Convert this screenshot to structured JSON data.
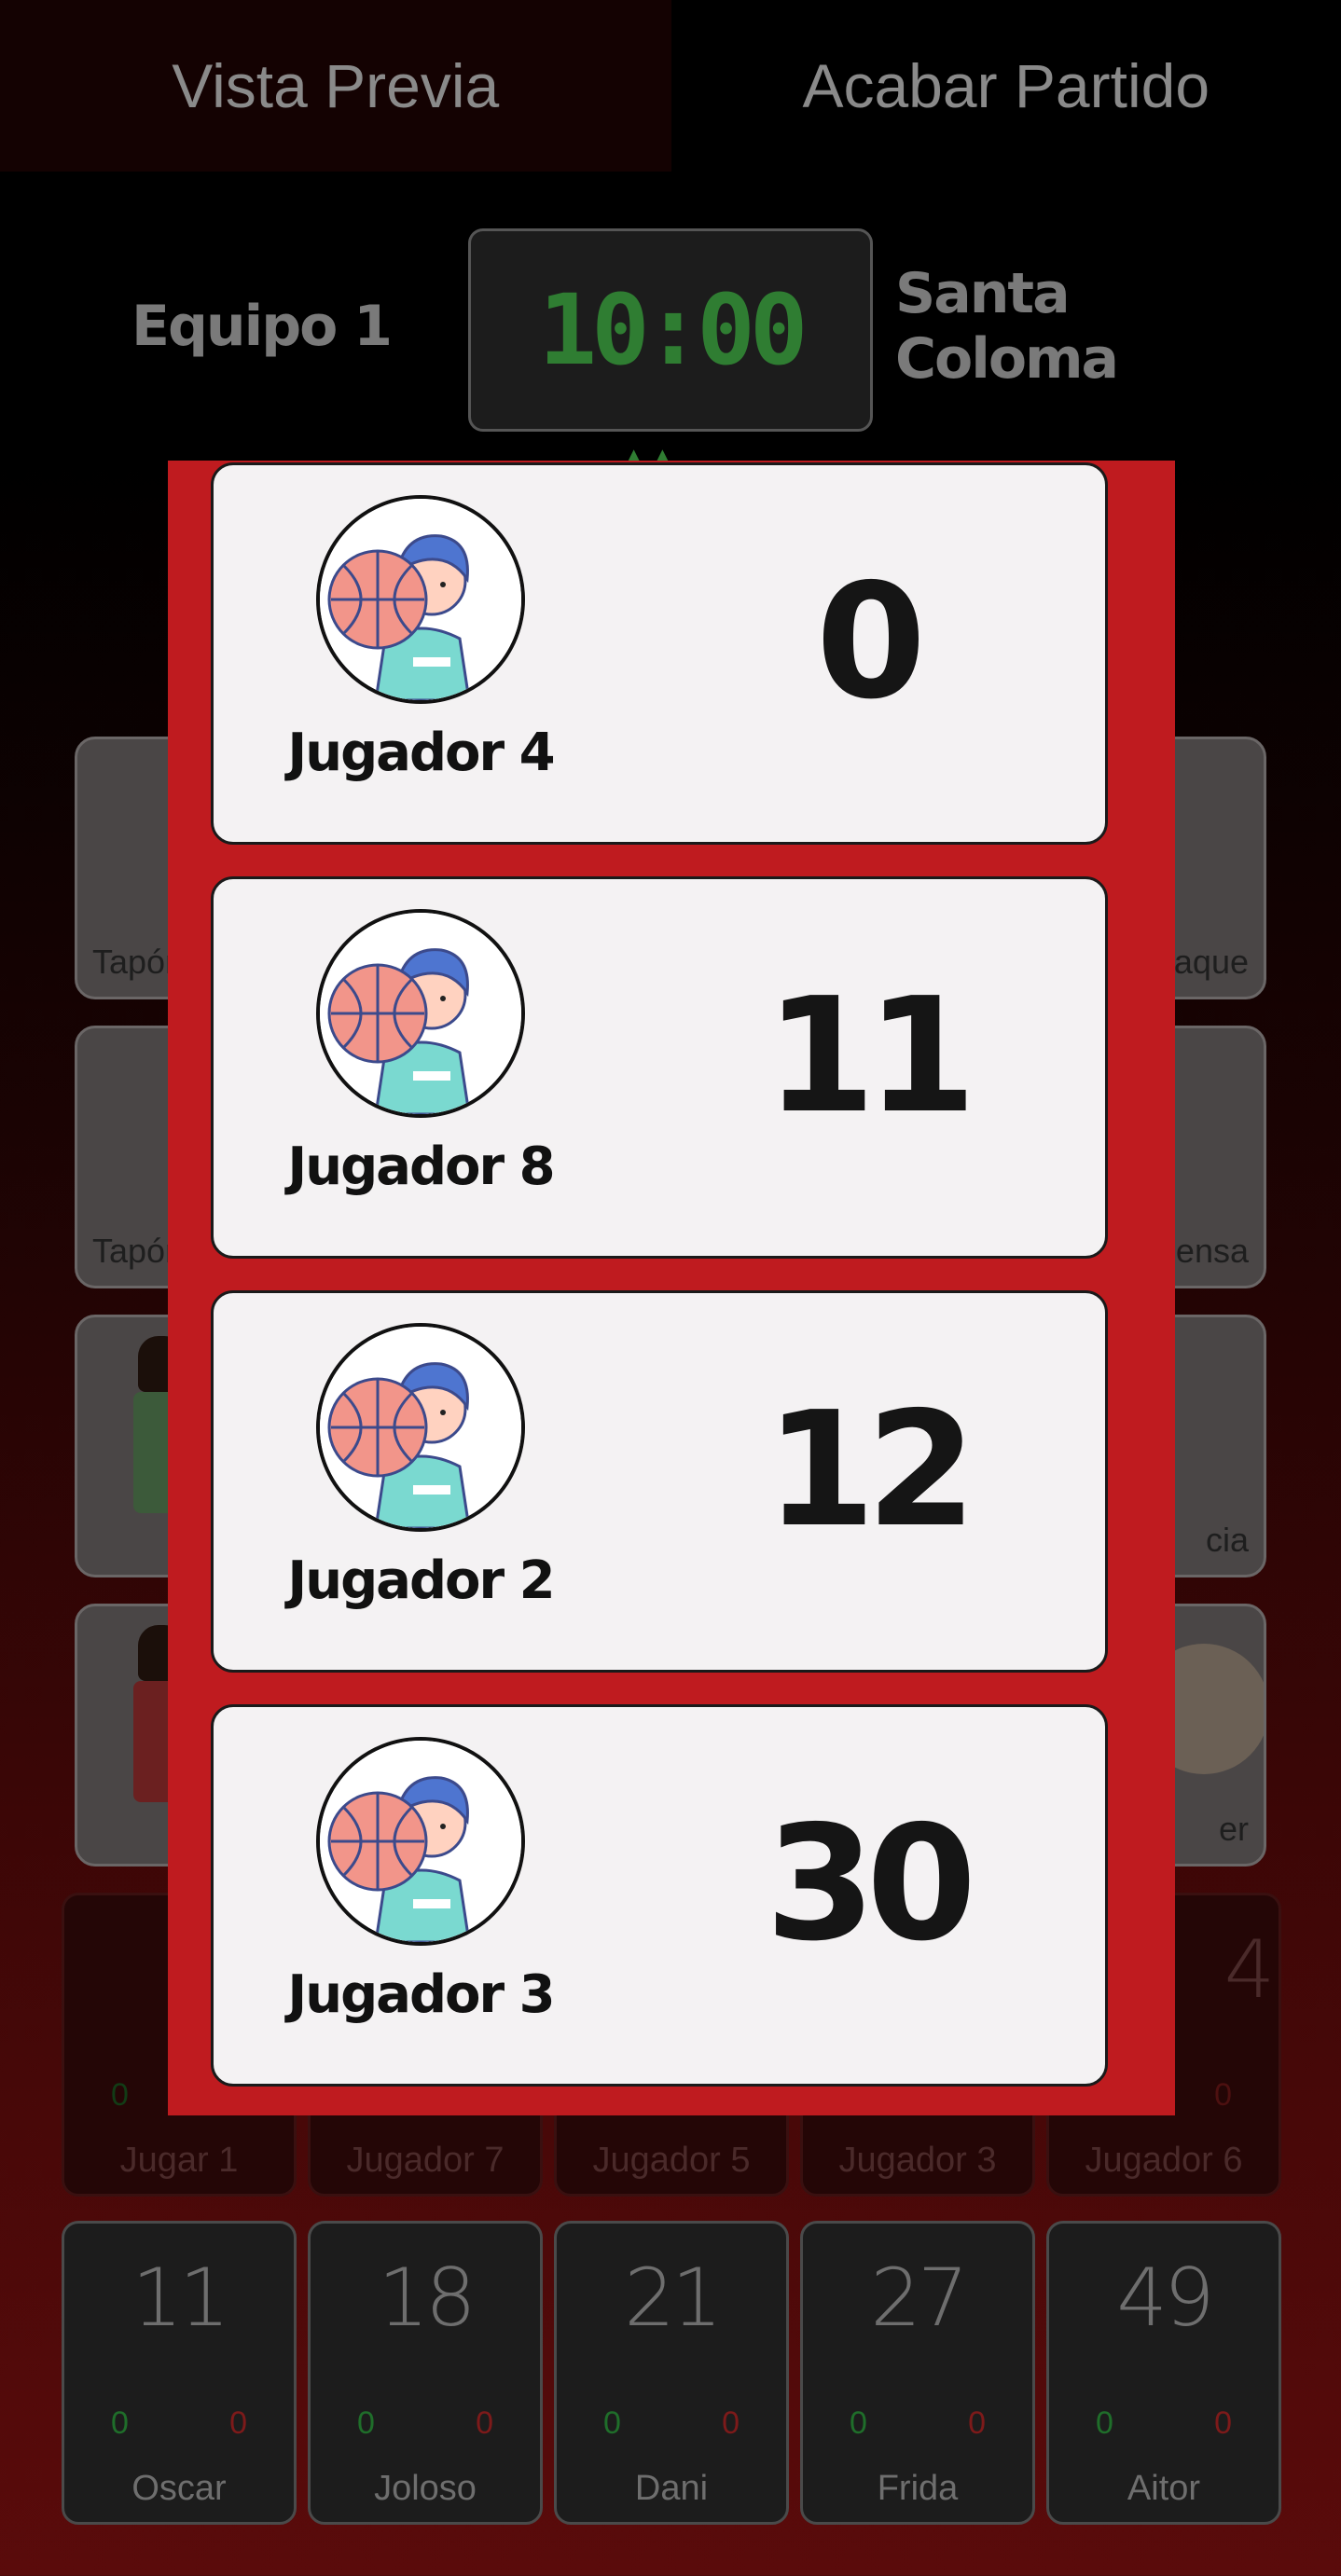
{
  "header": {
    "preview_tab": "Vista Previa",
    "end_match_tab": "Acabar Partido"
  },
  "scoreboard": {
    "home_team": "Equipo 1",
    "away_team": "Santa Coloma",
    "clock": "10:00"
  },
  "stat_buttons": {
    "left": [
      "Tapón",
      "Tapón",
      "",
      ""
    ],
    "right": [
      "aque",
      "ensa",
      "cia",
      "er"
    ]
  },
  "players_row1": [
    {
      "number": "",
      "made": "0",
      "missed": "",
      "name": "Jugar 1"
    },
    {
      "number": "",
      "made": "",
      "missed": "",
      "name": "Jugador 7"
    },
    {
      "number": "",
      "made": "",
      "missed": "",
      "name": "Jugador 5"
    },
    {
      "number": "",
      "made": "",
      "missed": "",
      "name": "Jugador 3"
    },
    {
      "number": "4",
      "made": "",
      "missed": "0",
      "name": "Jugador 6"
    }
  ],
  "players_row2": [
    {
      "number": "11",
      "made": "0",
      "missed": "0",
      "name": "Oscar"
    },
    {
      "number": "18",
      "made": "0",
      "missed": "0",
      "name": "Joloso"
    },
    {
      "number": "21",
      "made": "0",
      "missed": "0",
      "name": "Dani"
    },
    {
      "number": "27",
      "made": "0",
      "missed": "0",
      "name": "Frida"
    },
    {
      "number": "49",
      "made": "0",
      "missed": "0",
      "name": "Aitor"
    }
  ],
  "ranking": [
    {
      "name": "Jugador 4",
      "score": "0"
    },
    {
      "name": "Jugador 8",
      "score": "11"
    },
    {
      "name": "Jugador 2",
      "score": "12"
    },
    {
      "name": "Jugador 3",
      "score": "30"
    }
  ],
  "colors": {
    "modal_bg": "#bf1b1f",
    "clock_green": "#2f7d32",
    "card_bg": "#f4f2f3"
  }
}
